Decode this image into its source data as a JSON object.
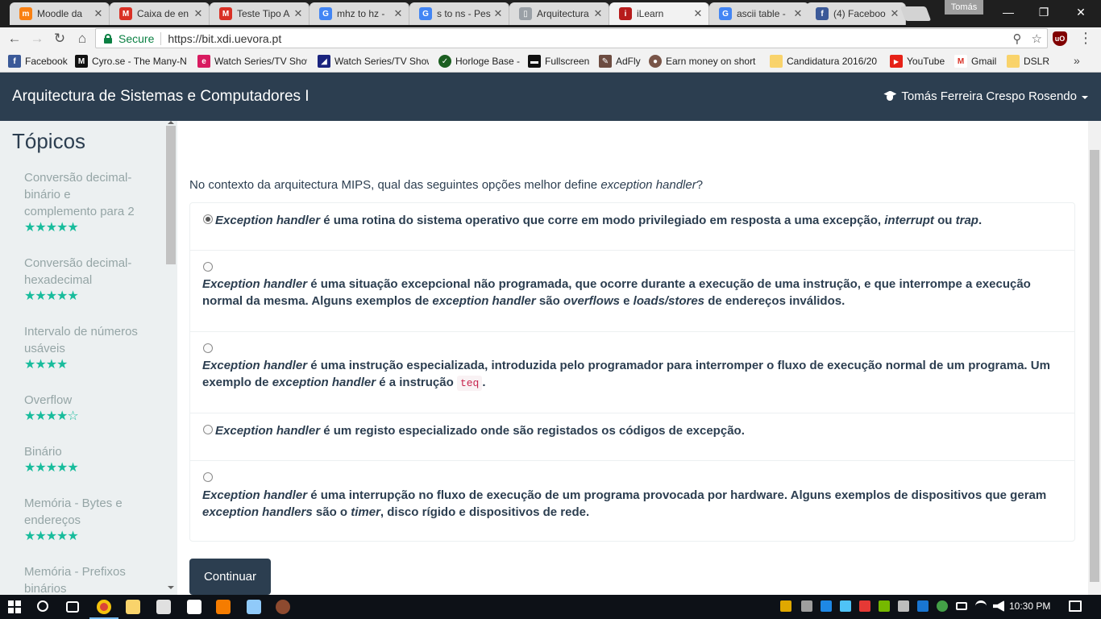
{
  "browser": {
    "tabs": [
      {
        "title": "Moodle da",
        "fav": "m",
        "color": "#f98012"
      },
      {
        "title": "Caixa de en",
        "fav": "M",
        "color": "#d93025"
      },
      {
        "title": "Teste Tipo A",
        "fav": "M",
        "color": "#d93025"
      },
      {
        "title": "mhz to hz -",
        "fav": "G",
        "color": "#4285f4"
      },
      {
        "title": "s to ns - Pes",
        "fav": "G",
        "color": "#4285f4"
      },
      {
        "title": "Arquitectura",
        "fav": "▯",
        "color": "#9aa0a6"
      },
      {
        "title": "iLearn",
        "fav": "i",
        "color": "#b71c1c"
      },
      {
        "title": "ascii table -",
        "fav": "G",
        "color": "#4285f4"
      },
      {
        "title": "(4) Faceboo",
        "fav": "f",
        "color": "#3b5998"
      }
    ],
    "profile_name": "Tomás",
    "secure_label": "Secure",
    "url": "https://bit.xdi.uevora.pt",
    "bookmarks": [
      {
        "label": "Facebook",
        "icon": "f",
        "color": "#3b5998"
      },
      {
        "label": "Cyro.se - The Many-N",
        "icon": "M",
        "color": "#111111"
      },
      {
        "label": "Watch Series/TV Show",
        "icon": "e",
        "color": "#d81b60"
      },
      {
        "label": "Watch Series/TV Show",
        "icon": "◢",
        "color": "#1a237e"
      },
      {
        "label": "Horloge Base -",
        "icon": "✓",
        "color": "#1b5e20"
      },
      {
        "label": "Fullscreen",
        "icon": "▬",
        "color": "#111111"
      },
      {
        "label": "AdFly",
        "icon": "✎",
        "color": "#6d4c41"
      },
      {
        "label": "Earn money on short l",
        "icon": "●",
        "color": "#795548"
      },
      {
        "label": "Candidatura 2016/20",
        "icon": "▭",
        "color": "#f9d36b"
      },
      {
        "label": "YouTube",
        "icon": "▶",
        "color": "#e62117"
      },
      {
        "label": "Gmail",
        "icon": "M",
        "color": "#d93025"
      },
      {
        "label": "DSLR",
        "icon": "▭",
        "color": "#f9d36b"
      }
    ]
  },
  "header": {
    "title": "Arquitectura de Sistemas e Computadores I",
    "user": "Tomás Ferreira Crespo Rosendo"
  },
  "sidebar": {
    "heading": "Tópicos",
    "items": [
      {
        "label": "Conversão decimal-binário e complemento para 2",
        "stars": "★★★★★"
      },
      {
        "label": "Conversão decimal-hexadecimal",
        "stars": "★★★★★"
      },
      {
        "label": "Intervalo de números usáveis",
        "stars": "★★★★"
      },
      {
        "label": "Overflow",
        "stars": "★★★★☆"
      },
      {
        "label": "Binário",
        "stars": "★★★★★"
      },
      {
        "label": "Memória - Bytes e endereços",
        "stars": "★★★★★"
      },
      {
        "label": "Memória - Prefixos binários",
        "stars": ""
      }
    ]
  },
  "question": {
    "prefix": "No contexto da arquitectura MIPS, qual das seguintes opções melhor define ",
    "term": "exception handler",
    "suffix": "?"
  },
  "options": [
    {
      "checked": true,
      "p1": "Exception handler",
      "t1": " é uma rotina do sistema operativo que corre em modo privilegiado em resposta a uma excepção, ",
      "p2": "interrupt",
      "t2": " ou ",
      "p3": "trap",
      "t3": "."
    },
    {
      "checked": false,
      "p1": "Exception handler",
      "t1": " é uma situação excepcional não programada, que ocorre durante a execução de uma instrução, e que interrompe a execução normal da mesma. Alguns exemplos de ",
      "p2": "exception handler",
      "t2": " são ",
      "p3": "overflows",
      "t3": " e ",
      "p4": "loads/stores",
      "t4": " de endereços inválidos."
    },
    {
      "checked": false,
      "p1": "Exception handler",
      "t1": " é uma instrução especializada, introduzida pelo programador para interromper o fluxo de execução normal de um programa. Um exemplo de ",
      "p2": "exception handler",
      "t2": " é a instrução ",
      "code": "teq",
      "t3": "."
    },
    {
      "checked": false,
      "p1": "Exception handler",
      "t1": " é um registo especializado onde são registados os códigos de excepção."
    },
    {
      "checked": false,
      "p1": "Exception handler",
      "t1": " é uma interrupção no fluxo de execução de um programa provocada por hardware. Alguns exemplos de dispositivos que geram ",
      "p2": "exception handlers",
      "t2": " são o ",
      "p3": "timer",
      "t3": ", disco rígido e dispositivos de rede."
    }
  ],
  "continue_label": "Continuar",
  "taskbar": {
    "clock": "10:30 PM"
  }
}
